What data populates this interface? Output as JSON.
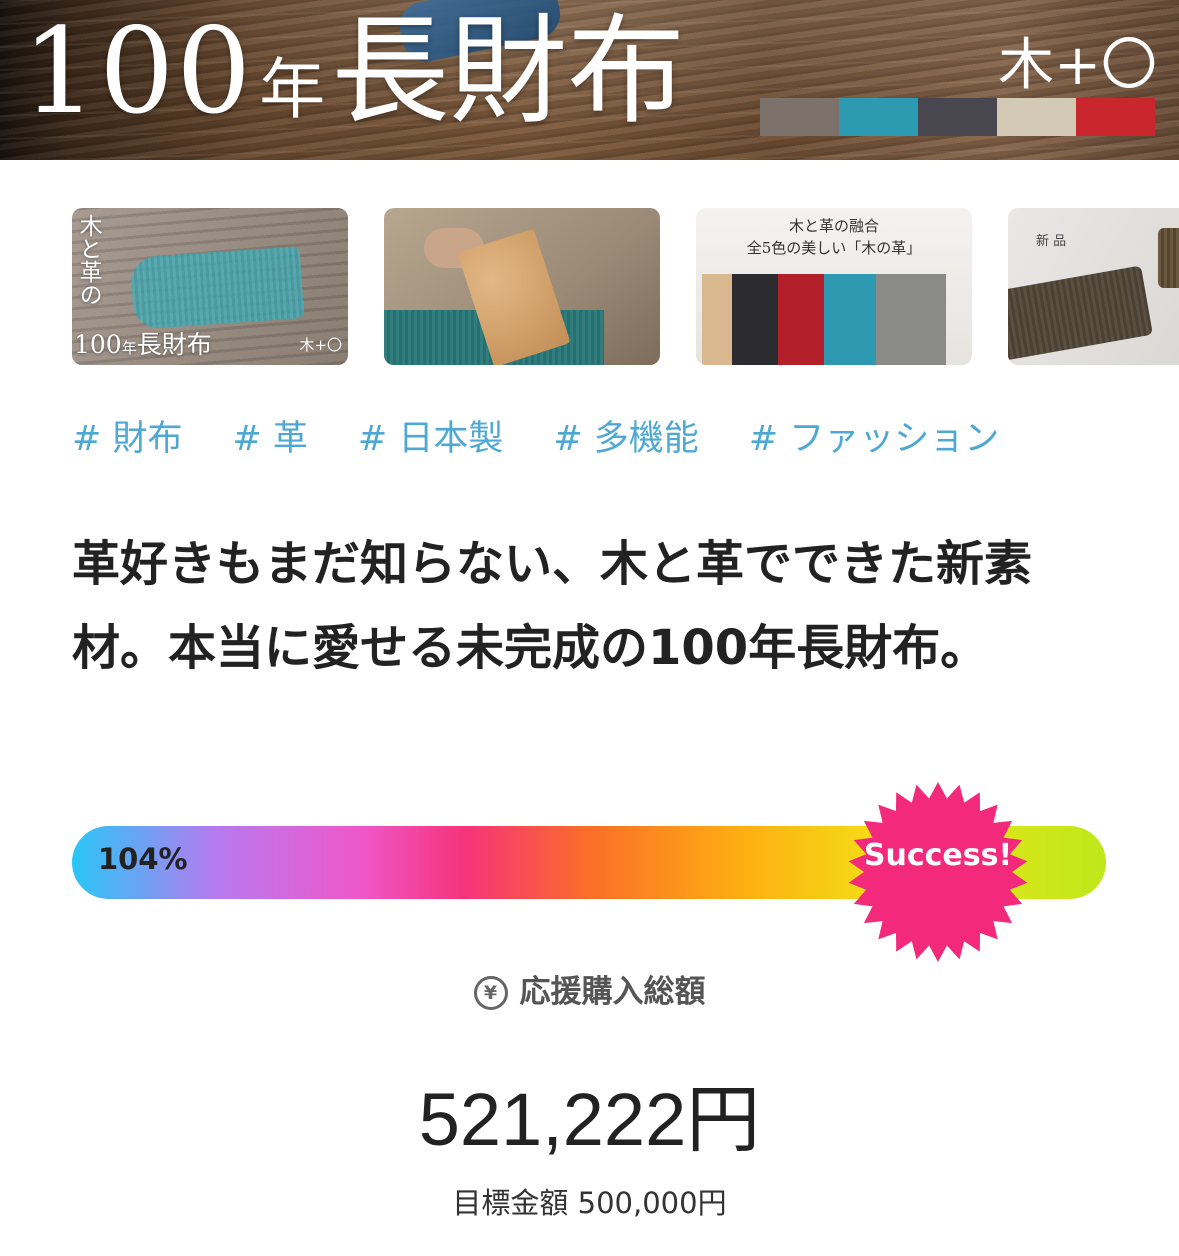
{
  "hero": {
    "title_num": "100",
    "title_nen": "年",
    "title_main": "長財布",
    "brand": "木+〇",
    "swatch_colors": [
      "#7d726b",
      "#2c9bb1",
      "#48464f",
      "#d3c9b5",
      "#c9262e"
    ]
  },
  "thumbnails": [
    {
      "vertical_text": "木と革の",
      "title_num": "100",
      "title_nen": "年",
      "title_main": "長財布",
      "brand": "木+〇"
    },
    {},
    {
      "caption_line1": "木と革の融合",
      "caption_line2": "全5色の美しい「木の革」",
      "bar_colors": [
        "#d9b88f",
        "#2b2b30",
        "#b3202a",
        "#2d98b0",
        "#8a8a88"
      ]
    },
    {
      "caption": "新 品"
    }
  ],
  "tags": [
    "# 財布",
    "# 革",
    "# 日本製",
    "# 多機能",
    "# ファッション"
  ],
  "headline": "革好きもまだ知らない、木と革でできた新素材。本当に愛せる未完成の100年長財布。",
  "progress": {
    "percent_label": "104%",
    "fraction": 1.04,
    "badge": "Success!",
    "badge_color": "#f3297c"
  },
  "totals": {
    "currency_icon": "yen-icon",
    "currency_symbol": "¥",
    "label": "応援購入総額",
    "amount": "521,222円",
    "goal": "目標金額 500,000円"
  }
}
